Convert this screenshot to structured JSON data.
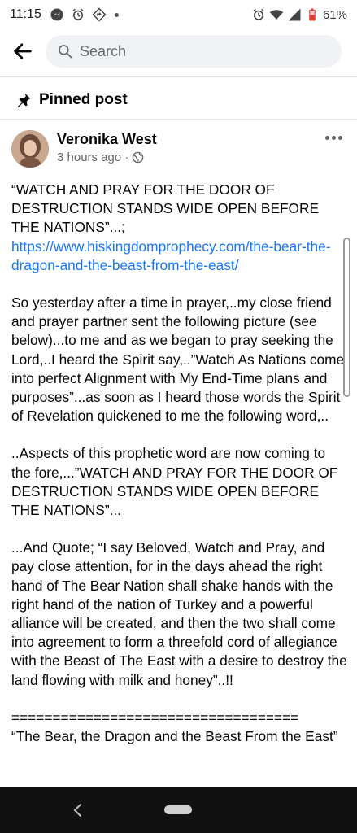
{
  "status_bar": {
    "time": "11:15",
    "battery": "61%",
    "icons_left": [
      "messenger-icon",
      "alarm-icon",
      "navigation-icon",
      "dot"
    ],
    "icons_right": [
      "alarm-icon",
      "wifi-icon",
      "signal-icon",
      "battery-icon"
    ]
  },
  "header": {
    "search_placeholder": "Search"
  },
  "pinned": {
    "label": "Pinned post"
  },
  "post": {
    "author": "Veronika West",
    "time": "3 hours ago",
    "separator": "·",
    "privacy_icon": "globe-icon",
    "paragraphs": {
      "p1_text": "“WATCH AND PRAY FOR THE DOOR OF DESTRUCTION STANDS WIDE OPEN BEFORE THE NATIONS”...;",
      "p1_link": "https://www.hiskingdomprophecy.com/the-bear-the-dragon-and-the-beast-from-the-east/",
      "p2": "So yesterday after a time in prayer,..my close friend and prayer partner sent the following picture (see below)...to me and as we began to pray seeking the Lord,..I heard the Spirit say,..”Watch As Nations come into perfect Alignment with My End-Time plans and purposes”...as soon as I heard those words the Spirit of Revelation quickened to me the following word,..",
      "p3": "..Aspects of this prophetic word are now coming to the fore,...”WATCH AND PRAY FOR THE DOOR OF DESTRUCTION STANDS WIDE OPEN BEFORE THE NATIONS”...",
      "p4": "...And Quote; “I say Beloved, Watch and Pray, and pay close attention, for in the days ahead the right hand of The Bear Nation shall shake hands with the right hand of the nation of Turkey and a powerful alliance will be created, and then the two shall come into agreement to form a threefold cord of allegiance with the Beast of The East with a desire to destroy the land flowing with milk and honey”..!!",
      "separator_line": "===================================",
      "p5": "“The Bear, the Dragon and the Beast From the East”"
    }
  },
  "colors": {
    "link": "#1877f2",
    "text": "#050505",
    "muted": "#65676b",
    "search_bg": "#f0f2f5",
    "navbar": "#111111"
  }
}
